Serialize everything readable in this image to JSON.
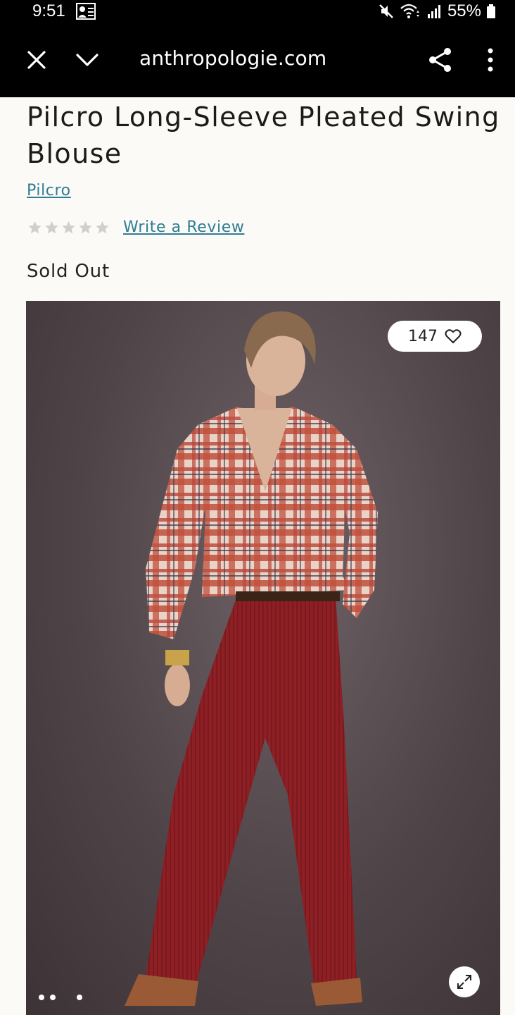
{
  "status_bar": {
    "time": "9:51",
    "battery": "55%"
  },
  "browser": {
    "url": "anthropologie.com"
  },
  "product": {
    "title": "Pilcro Long-Sleeve Pleated Swing Blouse",
    "brand": "Pilcro",
    "rating": 0,
    "rating_max": 5,
    "review_link": "Write a Review",
    "availability": "Sold Out",
    "likes": "147",
    "image_count": 3,
    "current_image": 1
  },
  "colors": {
    "link": "#2f7d93",
    "toolbar_bg": "#000000",
    "page_bg": "#fbfaf6",
    "star_empty": "#cfcfcf"
  },
  "icons": {
    "close": "close-icon",
    "collapse": "chevron-down-icon",
    "share": "share-icon",
    "more": "more-vertical-icon",
    "heart": "heart-icon",
    "expand": "expand-icon"
  }
}
